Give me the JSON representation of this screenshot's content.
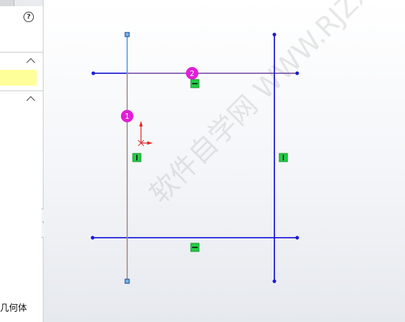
{
  "panel": {
    "help_symbol": "?",
    "bottom_label": "几何体"
  },
  "sketch": {
    "markers": [
      {
        "label": "1"
      },
      {
        "label": "2"
      }
    ],
    "relation_icons": [
      {
        "type": "horizontal-relation-icon",
        "symbol": "—"
      },
      {
        "type": "vertical-relation-icon",
        "symbol": "|"
      },
      {
        "type": "vertical-relation-icon",
        "symbol": "|"
      },
      {
        "type": "horizontal-relation-icon",
        "symbol": "—"
      }
    ],
    "watermark": "软件自学网 WWW.RJZXW.COM"
  },
  "colors": {
    "sketch_line": "#1a1ad6",
    "highlight_line": "#a68a8a",
    "marker": "#e01fd6",
    "relation": "#22cc44",
    "origin": "#e0282a",
    "field_highlight": "#ffff99"
  }
}
